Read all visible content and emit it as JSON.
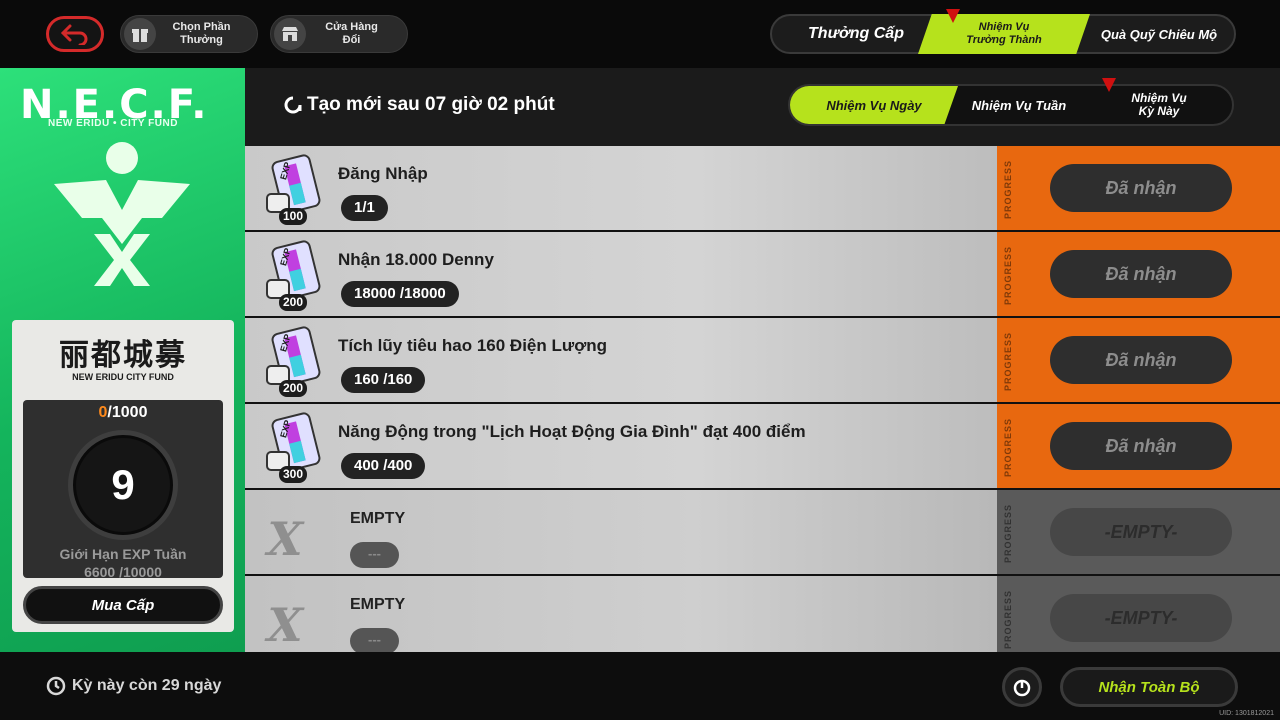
{
  "topbar": {
    "buttons": [
      {
        "label_line1": "Chọn Phần",
        "label_line2": "Thưởng",
        "icon": "gift-icon"
      },
      {
        "label_line1": "Cửa Hàng",
        "label_line2": "Đổi",
        "icon": "shop-icon"
      }
    ],
    "tabs": {
      "level_rewards": "Thưởng Cấp",
      "growth_missions_line1": "Nhiệm Vụ",
      "growth_missions_line2": "Trưởng Thành",
      "recruit_fund": "Quà Quỹ Chiêu Mộ"
    }
  },
  "left_panel": {
    "logo": "N.E.C.F.",
    "logo_sub": "NEW ERIDU • CITY FUND",
    "card_title_cn": "丽都城募",
    "card_title_en": "NEW ERIDU CITY FUND",
    "points_current": "0",
    "points_max": "/1000",
    "level": "9",
    "weekly_exp_label": "Giới Hạn EXP Tuần",
    "weekly_exp_value": "6600 /10000",
    "buy_level_label": "Mua Cấp"
  },
  "header": {
    "refresh_text": "Tạo mới sau 07 giờ 02 phút",
    "sub_tabs": {
      "daily": "Nhiệm Vụ Ngày",
      "weekly": "Nhiệm Vụ Tuần",
      "period_line1": "Nhiệm Vụ",
      "period_line2": "Kỳ Này"
    }
  },
  "progress_label": "PROGRESS",
  "tasks": [
    {
      "name": "Đăng Nhập",
      "progress": "1/1",
      "reward": "100",
      "status": "Đã nhận"
    },
    {
      "name": "Nhận 18.000 Denny",
      "progress": "18000 /18000",
      "reward": "200",
      "status": "Đã nhận"
    },
    {
      "name": "Tích lũy tiêu hao 160 Điện Lượng",
      "progress": "160 /160",
      "reward": "200",
      "status": "Đã nhận"
    },
    {
      "name": "Năng Động trong \"Lịch Hoạt Động Gia Đình\" đạt 400 điểm",
      "progress": "400 /400",
      "reward": "300",
      "status": "Đã nhận"
    }
  ],
  "empty_tasks": [
    {
      "name": "EMPTY",
      "progress": "---",
      "status": "-EMPTY-"
    },
    {
      "name": "EMPTY",
      "progress": "---",
      "status": "-EMPTY-"
    }
  ],
  "bottombar": {
    "period_remaining": "Kỳ này còn 29 ngày",
    "claim_all": "Nhận Toàn Bộ",
    "uid": "UID: 1301812021"
  },
  "colors": {
    "accent_green": "#b6e21c",
    "claimed_orange": "#e8680f",
    "panel_green": "#1fc86a",
    "alert_red": "#d01010"
  }
}
